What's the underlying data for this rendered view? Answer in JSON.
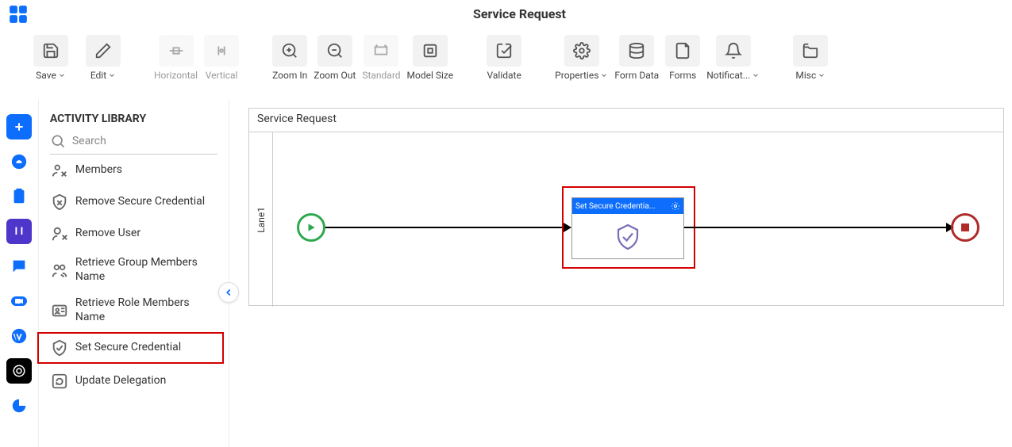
{
  "header": {
    "title": "Service Request"
  },
  "toolbar": {
    "save": "Save",
    "edit": "Edit",
    "horizontal": "Horizontal",
    "vertical": "Vertical",
    "zoom_in": "Zoom In",
    "zoom_out": "Zoom Out",
    "standard": "Standard",
    "model_size": "Model Size",
    "validate": "Validate",
    "properties": "Properties",
    "form_data": "Form Data",
    "forms": "Forms",
    "notifications": "Notificat...",
    "misc": "Misc"
  },
  "panel": {
    "title": "ACTIVITY LIBRARY",
    "search_placeholder": "Search",
    "items": [
      "Members",
      "Remove Secure Credential",
      "Remove User",
      "Retrieve Group Members Name",
      "Retrieve Role Members Name",
      "Set Secure Credential",
      "Update Delegation"
    ]
  },
  "canvas": {
    "title": "Service Request",
    "lane": "Lane1",
    "activity_label": "Set Secure Credentia..."
  }
}
